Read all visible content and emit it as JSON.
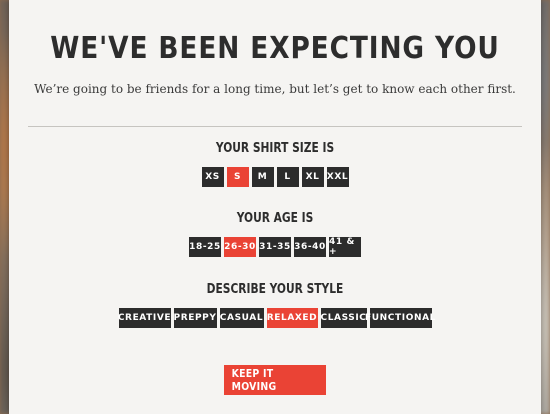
{
  "header": {
    "title": "WE'VE BEEN EXPECTING YOU",
    "subtitle": "We’re going to be friends for a long time, but let’s get to know each other first."
  },
  "shirt_size": {
    "label": "YOUR SHIRT SIZE IS",
    "options": [
      "XS",
      "S",
      "M",
      "L",
      "XL",
      "XXL"
    ],
    "selected": "S"
  },
  "age": {
    "label": "YOUR AGE IS",
    "options": [
      "18-25",
      "26-30",
      "31-35",
      "36-40",
      "41 & +"
    ],
    "selected": "26-30"
  },
  "style": {
    "label": "DESCRIBE YOUR STYLE",
    "options": [
      "CREATIVE",
      "PREPPY",
      "CASUAL",
      "RELAXED",
      "CLASSIC",
      "FUNCTIONAL"
    ],
    "selected": "RELAXED"
  },
  "cta": {
    "label": "KEEP IT MOVING"
  },
  "colors": {
    "accent": "#ea4335",
    "button_dark": "#2c2c2c",
    "card_bg": "#f5f4f2"
  }
}
